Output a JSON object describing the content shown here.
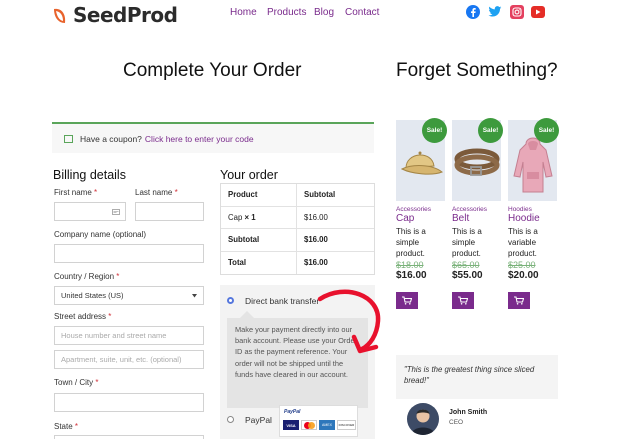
{
  "header": {
    "logo_text": "SeedProd",
    "nav": [
      "Home",
      "Products",
      "Blog",
      "Contact"
    ],
    "social_icons": [
      "facebook-icon",
      "twitter-icon",
      "instagram-icon",
      "youtube-icon"
    ]
  },
  "checkout": {
    "title": "Complete Your Order",
    "coupon_text": "Have a coupon?",
    "coupon_link": "Click here to enter your code",
    "billing": {
      "heading": "Billing details",
      "first_name": "First name",
      "last_name": "Last name",
      "company": "Company name (optional)",
      "country": "Country / Region",
      "country_value": "United States (US)",
      "street": "Street address",
      "street_placeholder": "House number and street name",
      "street2_placeholder": "Apartment, suite, unit, etc. (optional)",
      "city": "Town / City",
      "state": "State",
      "required_mark": "*"
    },
    "order": {
      "heading": "Your order",
      "col_product": "Product",
      "col_subtotal": "Subtotal",
      "item_name": "Cap",
      "item_qty": "× 1",
      "item_price": "$16.00",
      "subtotal_label": "Subtotal",
      "subtotal_value": "$16.00",
      "total_label": "Total",
      "total_value": "$16.00"
    },
    "payment": {
      "bank_label": "Direct bank transfer",
      "bank_desc": "Make your payment directly into our bank account. Please use your Order ID as the payment reference. Your order will not be shipped until the funds have cleared in our account.",
      "paypal_label": "PayPal",
      "paypal_badge": "PayPal",
      "cards": [
        "VISA",
        "MC",
        "AMEX",
        "DISCOVER"
      ]
    }
  },
  "upsell": {
    "title": "Forget Something?",
    "sale_badge": "Sale!",
    "products": [
      {
        "category": "Accessories",
        "name": "Cap",
        "desc": [
          "This is a",
          "simple",
          "product."
        ],
        "old_price": "$18.00",
        "price": "$16.00"
      },
      {
        "category": "Accessories",
        "name": "Belt",
        "desc": [
          "This is a",
          "simple",
          "product."
        ],
        "old_price": "$65.00",
        "price": "$55.00"
      },
      {
        "category": "Hoodies",
        "name": "Hoodie",
        "desc": [
          "This is a",
          "variable",
          "product."
        ],
        "old_price": "$25.00",
        "price": "$20.00"
      }
    ],
    "testimonial": {
      "quote": "\"This is the greatest thing since sliced bread!\"",
      "name": "John Smith",
      "role": "CEO"
    }
  },
  "colors": {
    "accent": "#7a2b8c",
    "sale_green": "#3d9a3d",
    "arrow_red": "#e8112d"
  }
}
